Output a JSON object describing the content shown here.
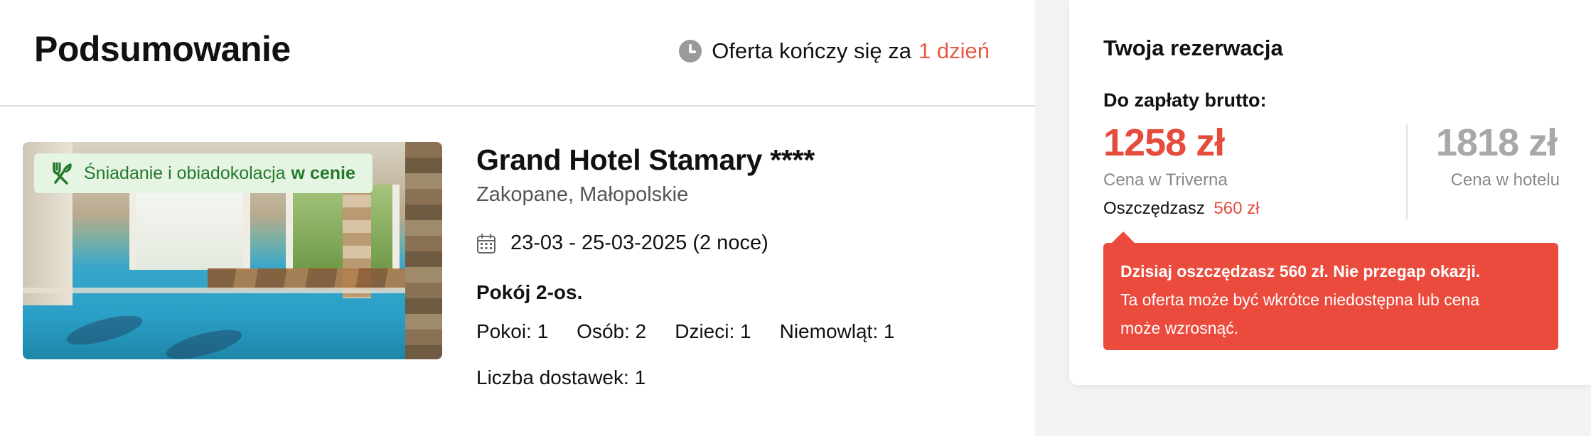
{
  "summary": {
    "title": "Podsumowanie",
    "offer_timer": {
      "icon": "clock-icon",
      "text": "Oferta kończy się za",
      "highlight": "1 dzień",
      "highlight_color": "#e85a45"
    }
  },
  "hotel": {
    "meal_badge": {
      "icon": "cutlery-icon",
      "text": "Śniadanie i obiadokolacja",
      "bold": "w cenie"
    },
    "name": "Grand Hotel Stamary ****",
    "location": "Zakopane, Małopolskie",
    "dates": "23-03 - 25-03-2025 (2 noce)",
    "room_type": "Pokój 2-os.",
    "occupancy": {
      "rooms": "Pokoi: 1",
      "persons": "Osób: 2",
      "children": "Dzieci: 1",
      "infants": "Niemowląt: 1"
    },
    "extra_beds": "Liczba dostawek: 1"
  },
  "reservation": {
    "title": "Twoja rezerwacja",
    "pay_label": "Do zapłaty brutto:",
    "price_triverna": "1258 zł",
    "price_triverna_label": "Cena w Triverna",
    "savings_label": "Oszczędzasz",
    "savings_value": "560 zł",
    "price_hotel": "1818 zł",
    "price_hotel_label": "Cena w hotelu",
    "alert": {
      "title": "Dzisiaj oszczędzasz 560 zł. Nie przegap okazji.",
      "text_line1": "Ta oferta może być wkrótce niedostępna lub cena",
      "text_line2": "może wzrosnąć."
    },
    "accent_color": "#e64c3c"
  }
}
